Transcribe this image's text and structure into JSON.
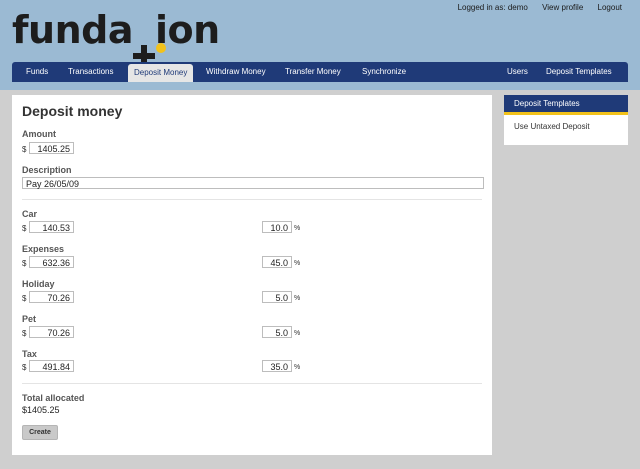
{
  "brand": {
    "logo_a": "funda",
    "logo_b": "ion"
  },
  "header": {
    "logged_in": "Logged in as: demo",
    "view_profile": "View profile",
    "logout": "Logout"
  },
  "nav": {
    "left": [
      "Funds",
      "Transactions",
      "Deposit Money",
      "Withdraw Money",
      "Transfer Money",
      "Synchronize"
    ],
    "right": [
      "Users",
      "Deposit Templates"
    ],
    "active": "Deposit Money"
  },
  "form": {
    "title": "Deposit money",
    "amount_label": "Amount",
    "currency": "$",
    "amount_value": "1405.25",
    "description_label": "Description",
    "description_value": "Pay 26/05/09",
    "percent_sign": "%",
    "categories": [
      {
        "name": "Car",
        "amount": "140.53",
        "percent": "10.0"
      },
      {
        "name": "Expenses",
        "amount": "632.36",
        "percent": "45.0"
      },
      {
        "name": "Holiday",
        "amount": "70.26",
        "percent": "5.0"
      },
      {
        "name": "Pet",
        "amount": "70.26",
        "percent": "5.0"
      },
      {
        "name": "Tax",
        "amount": "491.84",
        "percent": "35.0"
      }
    ],
    "total_label": "Total allocated",
    "total_value": "$1405.25",
    "create_button": "Create"
  },
  "sidebar": {
    "title": "Deposit Templates",
    "items": [
      "Use Untaxed Deposit"
    ]
  },
  "colors": {
    "nav_bg": "#1f3a78",
    "header_bg": "#9bbad3",
    "accent": "#f2c21b"
  }
}
